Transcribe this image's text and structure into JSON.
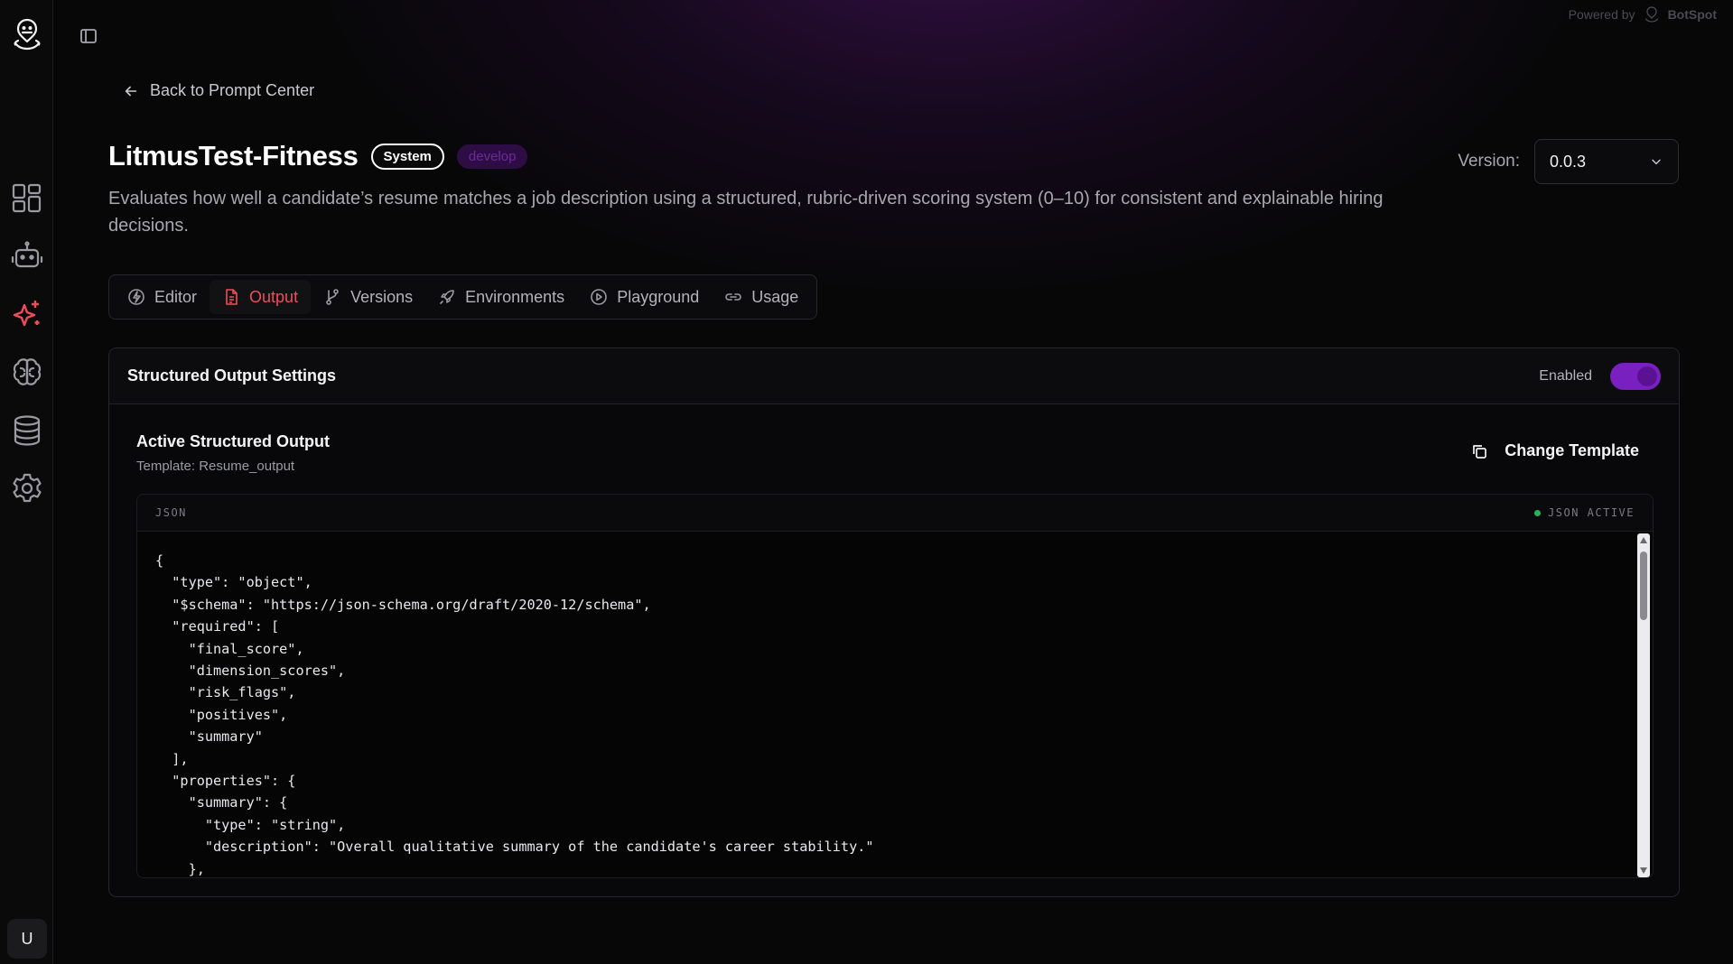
{
  "powered_by": {
    "label": "Powered by",
    "brand": "BotSpot"
  },
  "sidebar": {
    "items": [
      {
        "name": "dashboard",
        "icon": "grid-icon"
      },
      {
        "name": "bots",
        "icon": "robot-icon"
      },
      {
        "name": "prompts",
        "icon": "sparkles-icon",
        "active": true
      },
      {
        "name": "knowledge",
        "icon": "brain-icon"
      },
      {
        "name": "database",
        "icon": "database-icon"
      },
      {
        "name": "settings",
        "icon": "gear-icon"
      }
    ],
    "avatar": "U",
    "accent_color": "#ef4d58"
  },
  "header": {
    "back_label": "Back to Prompt Center",
    "title": "LitmusTest-Fitness",
    "badge_system": "System",
    "badge_env": "develop",
    "description": "Evaluates how well a candidate’s resume matches a job description using a structured, rubric-driven scoring system (0–10) for consistent and explainable hiring decisions.",
    "version_label": "Version:",
    "version_value": "0.0.3"
  },
  "tabs": [
    {
      "label": "Editor",
      "icon": "bolt-icon"
    },
    {
      "label": "Output",
      "icon": "file-icon",
      "active": true
    },
    {
      "label": "Versions",
      "icon": "branch-icon"
    },
    {
      "label": "Environments",
      "icon": "rocket-icon"
    },
    {
      "label": "Playground",
      "icon": "play-icon"
    },
    {
      "label": "Usage",
      "icon": "link-icon"
    }
  ],
  "structured_output": {
    "section_title": "Structured Output Settings",
    "toggle_label": "Enabled",
    "toggle_on": true,
    "toggle_color": "#7a1fc0",
    "active_title": "Active Structured Output",
    "template_label": "Template: Resume_output",
    "change_button": "Change Template",
    "code_lang": "JSON",
    "code_status": "JSON ACTIVE",
    "status_color": "#22b35c",
    "code": "{\n  \"type\": \"object\",\n  \"$schema\": \"https://json-schema.org/draft/2020-12/schema\",\n  \"required\": [\n    \"final_score\",\n    \"dimension_scores\",\n    \"risk_flags\",\n    \"positives\",\n    \"summary\"\n  ],\n  \"properties\": {\n    \"summary\": {\n      \"type\": \"string\",\n      \"description\": \"Overall qualitative summary of the candidate's career stability.\"\n    },"
  }
}
